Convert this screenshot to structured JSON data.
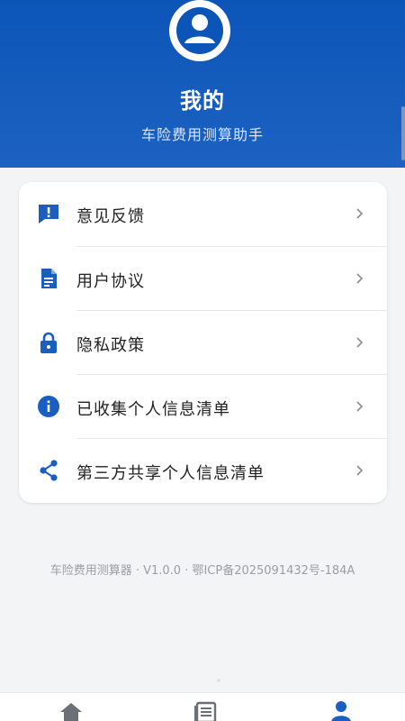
{
  "header": {
    "title": "我的",
    "subtitle": "车险费用测算助手"
  },
  "menu": {
    "items": [
      {
        "label": "意见反馈",
        "icon": "feedback-icon"
      },
      {
        "label": "用户协议",
        "icon": "document-icon"
      },
      {
        "label": "隐私政策",
        "icon": "lock-icon"
      },
      {
        "label": "已收集个人信息清单",
        "icon": "info-icon"
      },
      {
        "label": "第三方共享个人信息清单",
        "icon": "share-icon"
      }
    ]
  },
  "footer": {
    "note": "车险费用测算器 · V1.0.0 · 鄂ICP备2025091432号-184A"
  },
  "bottom_nav": {
    "items": [
      {
        "icon": "home-icon",
        "active": false
      },
      {
        "icon": "list-icon",
        "active": false
      },
      {
        "icon": "profile-icon",
        "active": true
      }
    ]
  },
  "colors": {
    "primary": "#0c55b8",
    "icon": "#1a5fc0",
    "inactive_nav": "#6b6f76"
  }
}
